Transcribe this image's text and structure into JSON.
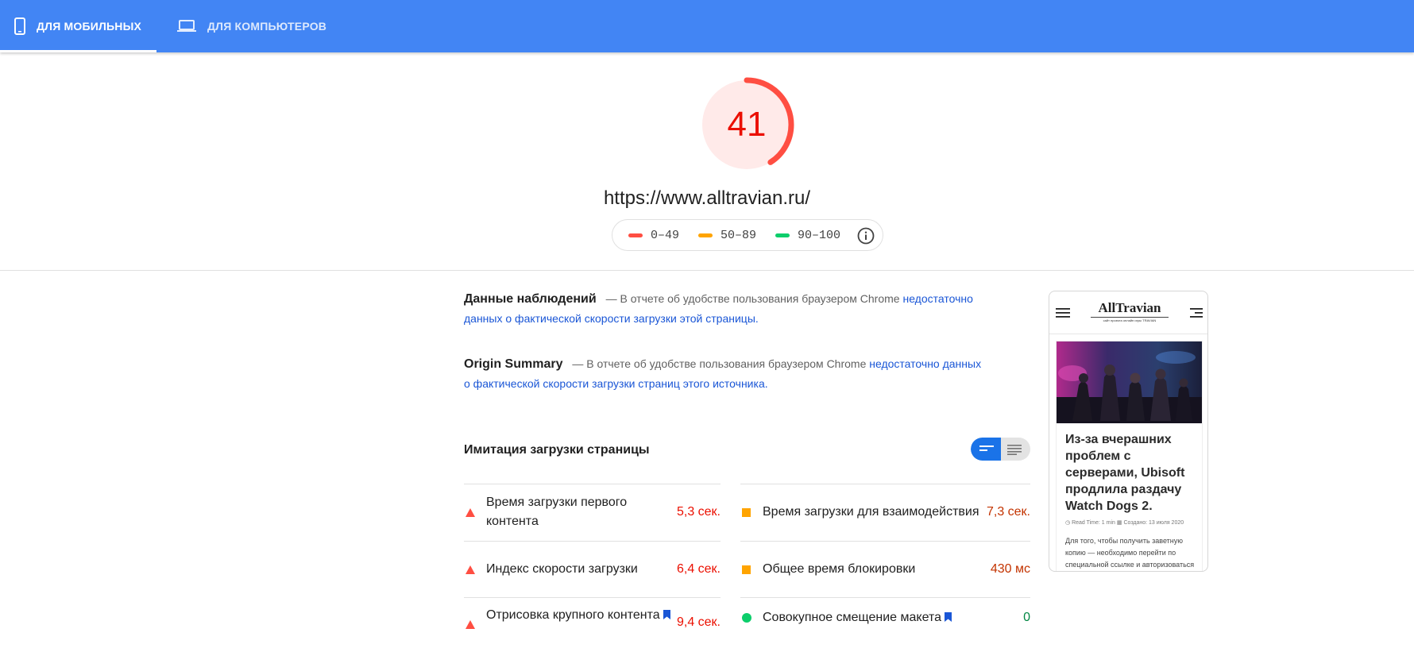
{
  "tabs": {
    "mobile_label": "ДЛЯ МОБИЛЬНЫХ",
    "desktop_label": "ДЛЯ КОМПЬЮТЕРОВ"
  },
  "score": {
    "value": "41",
    "fraction": 0.41,
    "color": "#ff4e42"
  },
  "page_url": "https://www.alltravian.ru/",
  "legend": {
    "ranges": [
      "0–49",
      "50–89",
      "90–100"
    ],
    "colors": [
      "#ff4e42",
      "#ffa400",
      "#0cce6b"
    ]
  },
  "field_data": {
    "title": "Данные наблюдений",
    "text": "— В отчете об удобстве пользования браузером Chrome",
    "link": "недостаточно данных о фактической скорости загрузки этой страницы."
  },
  "origin_summary": {
    "title": "Origin Summary",
    "text": "— В отчете об удобстве пользования браузером Chrome",
    "link": "недостаточно данных о фактической скорости загрузки страниц этого источника."
  },
  "lab": {
    "title": "Имитация загрузки страницы"
  },
  "metrics": [
    {
      "label": "Время загрузки первого контента",
      "value": "5,3 сек.",
      "status": "fail"
    },
    {
      "label": "Время загрузки для взаимодействия",
      "value": "7,3 сек.",
      "status": "average"
    },
    {
      "label": "Индекс скорости загрузки",
      "value": "6,4 сек.",
      "status": "fail"
    },
    {
      "label": "Общее время блокировки",
      "value": "430 мс",
      "status": "average"
    },
    {
      "label": "Отрисовка крупного контента",
      "value": "9,4 сек.",
      "status": "fail"
    },
    {
      "label": "Совокупное смещение макета",
      "value": "0",
      "status": "pass"
    }
  ],
  "preview": {
    "logo": "AllTravian",
    "tagline": "сайт проекта онлайн игры TRAVIAN",
    "article_title": "Из-за вчерашних проблем с серверами, Ubisoft продлила раздачу Watch Dogs 2.",
    "meta_read": "Read Time: 1 min",
    "meta_date": "Создано: 13 июля 2020",
    "excerpt": "Для того, чтобы получить заветную копию — необходимо перейти по специальной ссылке и авторизоваться с"
  }
}
